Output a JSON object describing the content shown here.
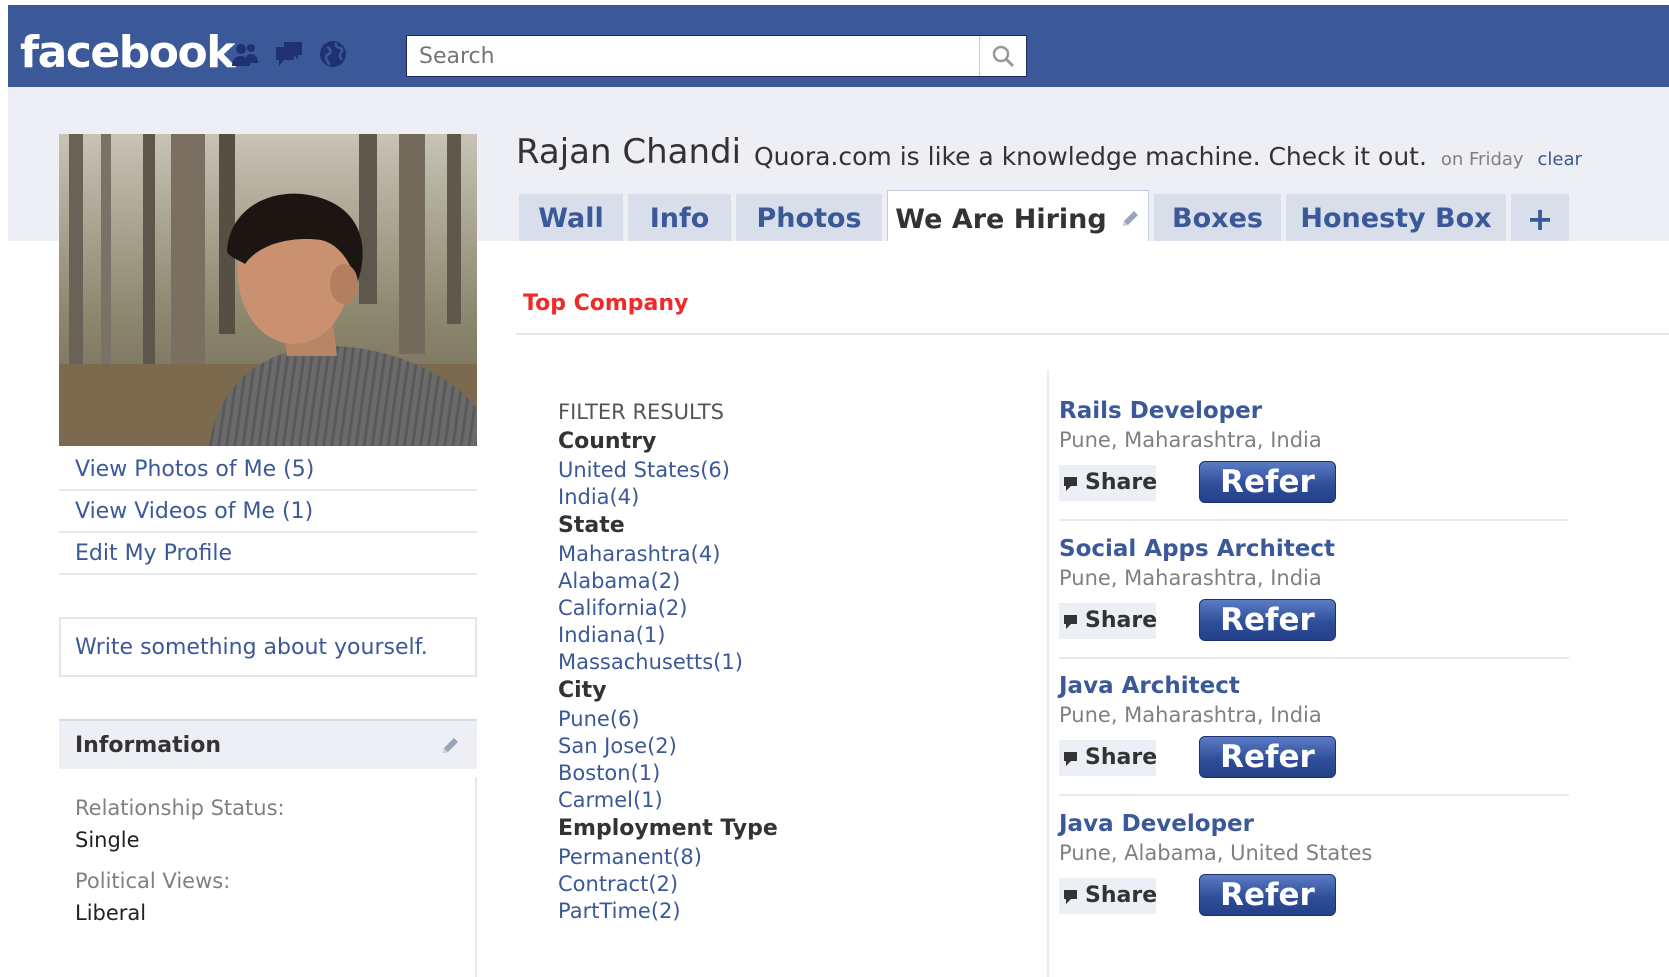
{
  "header": {
    "logo_text": "facebook",
    "search_placeholder": "Search"
  },
  "sidebar": {
    "links": [
      {
        "label": "View Photos of Me (5)"
      },
      {
        "label": "View Videos of Me (1)"
      },
      {
        "label": "Edit My Profile"
      }
    ],
    "about_placeholder": "Write something about yourself.",
    "information": {
      "title": "Information",
      "fields": [
        {
          "label": "Relationship Status:",
          "value": "Single"
        },
        {
          "label": "Political Views:",
          "value": "Liberal"
        }
      ]
    }
  },
  "profile": {
    "name": "Rajan Chandi",
    "status": "Quora.com is like a knowledge machine. Check it out.",
    "status_time": "on Friday",
    "clear_label": "clear"
  },
  "tabs": [
    {
      "label": "Wall"
    },
    {
      "label": "Info"
    },
    {
      "label": "Photos"
    },
    {
      "label": "We Are Hiring"
    },
    {
      "label": "Boxes"
    },
    {
      "label": "Honesty Box"
    },
    {
      "label": "+"
    }
  ],
  "content": {
    "section_title": "Top Company",
    "filter": {
      "title": "FILTER RESULTS",
      "country_heading": "Country",
      "countries": [
        "United States(6)",
        "India(4)"
      ],
      "state_heading": "State",
      "states": [
        "Maharashtra(4)",
        "Alabama(2)",
        "California(2)",
        "Indiana(1)",
        "Massachusetts(1)"
      ],
      "city_heading": "City",
      "cities": [
        "Pune(6)",
        "San Jose(2)",
        "Boston(1)",
        "Carmel(1)"
      ],
      "employment_heading": "Employment Type",
      "employment": [
        "Permanent(8)",
        "Contract(2)",
        "PartTime(2)"
      ]
    },
    "share_label": "Share",
    "refer_label": "Refer",
    "jobs": [
      {
        "title": "Rails Developer",
        "location": "Pune, Maharashtra, India"
      },
      {
        "title": "Social Apps Architect",
        "location": "Pune, Maharashtra, India"
      },
      {
        "title": "Java Architect",
        "location": "Pune, Maharashtra, India"
      },
      {
        "title": "Java Developer",
        "location": "Pune, Alabama, United States"
      }
    ]
  },
  "colors": {
    "brand_blue": "#3b5998",
    "tab_bg": "#d8dfea",
    "accent_red": "#ee2a2a"
  },
  "icons": [
    "friends-icon",
    "messages-icon",
    "notifications-globe-icon",
    "search-icon",
    "pencil-icon",
    "share-icon"
  ]
}
